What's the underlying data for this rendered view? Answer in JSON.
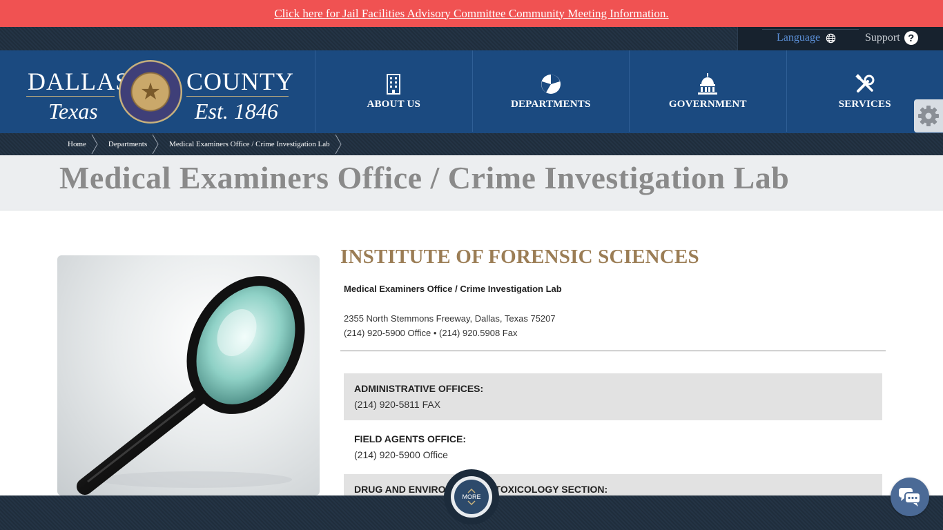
{
  "alert": {
    "text": "Click here for Jail Facilities Advisory Committee Community Meeting Information."
  },
  "utility": {
    "language_label": "Language",
    "support_label": "Support",
    "support_icon": "?"
  },
  "logo": {
    "left_word": "DALLAS",
    "right_word": "COUNTY",
    "left_script": "Texas",
    "right_script": "Est. 1846",
    "seal_icon": "★"
  },
  "nav": {
    "items": [
      {
        "label": "ABOUT US",
        "icon": "building-icon"
      },
      {
        "label": "DEPARTMENTS",
        "icon": "pie-chart-icon"
      },
      {
        "label": "GOVERNMENT",
        "icon": "capitol-icon"
      },
      {
        "label": "SERVICES",
        "icon": "tools-icon"
      }
    ]
  },
  "breadcrumb": {
    "items": [
      "Home",
      "Departments",
      "Medical Examiners Office / Crime Investigation Lab"
    ]
  },
  "page": {
    "title": "Medical Examiners Office / Crime Investigation Lab"
  },
  "content": {
    "heading": "INSTITUTE OF FORENSIC SCIENCES",
    "subheading": "Medical Examiners Office / Crime Investigation Lab",
    "address_line": "2355 North Stemmons Freeway, Dallas, Texas 75207",
    "phone_line": "(214) 920-5900 Office • (214) 920.5908 Fax",
    "sections": [
      {
        "heading": "ADMINISTRATIVE OFFICES:",
        "line": "(214) 920-5811 FAX"
      },
      {
        "heading": "FIELD AGENTS OFFICE:",
        "line": "(214) 920-5900 Office"
      },
      {
        "heading": "DRUG AND ENVIRONMENTAL TOXICOLOGY SECTION:",
        "line": ""
      }
    ]
  },
  "footer": {
    "more_label": "MORE"
  },
  "colors": {
    "alert": "#f05252",
    "header": "#1b4a80",
    "heading_gold": "#9b7d55",
    "dark_bar": "#1f2d3c"
  }
}
